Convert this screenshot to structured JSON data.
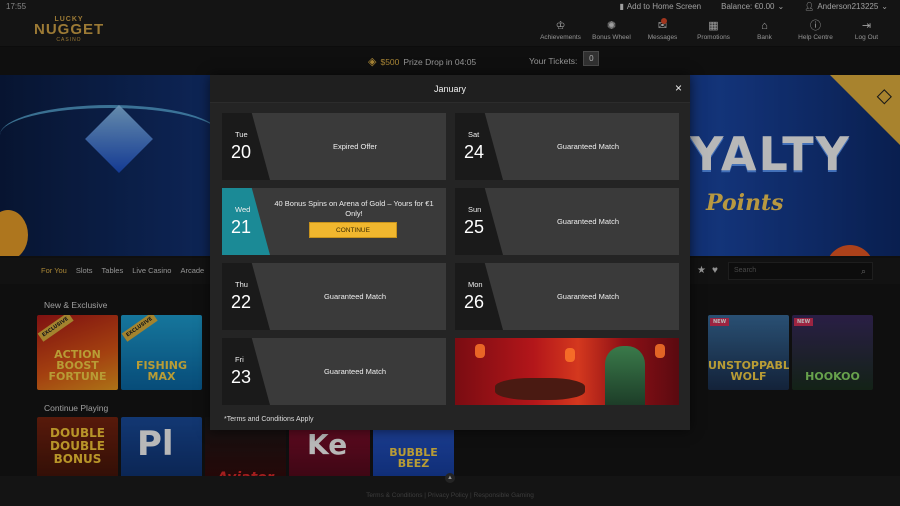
{
  "status": {
    "time": "17:55",
    "add_home": "Add to Home Screen",
    "balance": "Balance: €0.00",
    "user": "Anderson213225"
  },
  "logo": {
    "line1": "LUCKY",
    "line2": "NUGGET",
    "line3": "CASINO"
  },
  "nav": [
    {
      "label": "Achievements",
      "icon": "crown-icon"
    },
    {
      "label": "Bonus Wheel",
      "icon": "wheel-icon"
    },
    {
      "label": "Messages",
      "icon": "mail-icon"
    },
    {
      "label": "Promotions",
      "icon": "calendar-icon"
    },
    {
      "label": "Bank",
      "icon": "bank-icon"
    },
    {
      "label": "Help Centre",
      "icon": "help-icon"
    },
    {
      "label": "Log Out",
      "icon": "logout-icon"
    }
  ],
  "prize": {
    "amount": "$500",
    "text": "Prize Drop in 04:05",
    "tickets_label": "Your Tickets:",
    "tickets": "0"
  },
  "banner": {
    "title": "YALTY",
    "subtitle": "Points"
  },
  "categories": [
    "For You",
    "Slots",
    "Tables",
    "Live Casino",
    "Arcade"
  ],
  "search": {
    "placeholder": "Search"
  },
  "sections": {
    "new": "New & Exclusive",
    "continue": "Continue Playing"
  },
  "tiles_new": [
    {
      "title": "ACTION BOOST FORTUNE",
      "tag": "EXCLUSIVE"
    },
    {
      "title": "FISHING MAX",
      "tag": "EXCLUSIVE"
    },
    {
      "title": "UNSTOPPABLE WOLF",
      "tag": "NEW"
    },
    {
      "title": "HOOKOO",
      "tag": "NEW"
    }
  ],
  "tiles_continue": [
    {
      "title": "DOUBLE DOUBLE BONUS"
    },
    {
      "title": "Pl"
    },
    {
      "title": "Aviator"
    },
    {
      "title": "Ke"
    },
    {
      "title": "BUBBLE BEEZ"
    }
  ],
  "footer": {
    "links": "Terms & Conditions  |  Privacy Policy  |  Responsible Gaming"
  },
  "modal": {
    "title": "January",
    "close": "×",
    "terms": "*Terms and Conditions Apply",
    "days": [
      {
        "dow": "Tue",
        "num": "20",
        "label": "Expired Offer"
      },
      {
        "dow": "Sat",
        "num": "24",
        "label": "Guaranteed Match"
      },
      {
        "dow": "Wed",
        "num": "21",
        "offer": "40 Bonus Spins on Arena of Gold – Yours for €1 Only!",
        "button": "CONTINUE"
      },
      {
        "dow": "Sun",
        "num": "25",
        "label": "Guaranteed Match"
      },
      {
        "dow": "Thu",
        "num": "22",
        "label": "Guaranteed Match"
      },
      {
        "dow": "Mon",
        "num": "26",
        "label": "Guaranteed Match"
      },
      {
        "dow": "Fri",
        "num": "23",
        "label": "Guaranteed Match"
      }
    ]
  }
}
